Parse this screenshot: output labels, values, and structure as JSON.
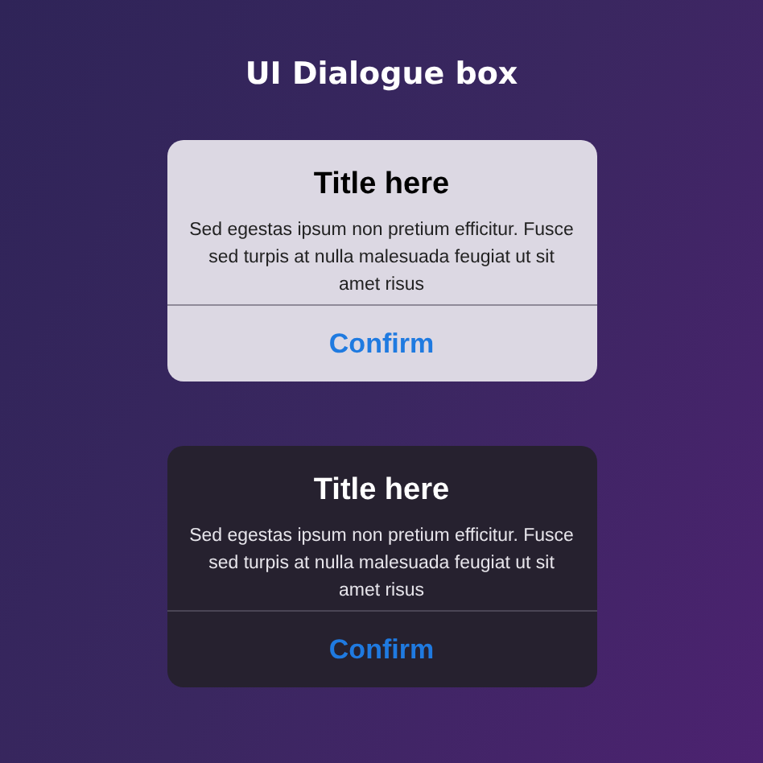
{
  "heading": "UI Dialogue box",
  "dialogs": [
    {
      "kind": "light",
      "title": "Title here",
      "message": "Sed egestas ipsum non pretium efficitur. Fusce sed turpis at nulla malesuada feugiat ut sit amet risus",
      "button": "Confirm"
    },
    {
      "kind": "dark",
      "title": "Title here",
      "message": "Sed egestas ipsum non pretium efficitur. Fusce sed turpis at nulla malesuada feugiat ut sit amet risus",
      "button": "Confirm"
    }
  ]
}
